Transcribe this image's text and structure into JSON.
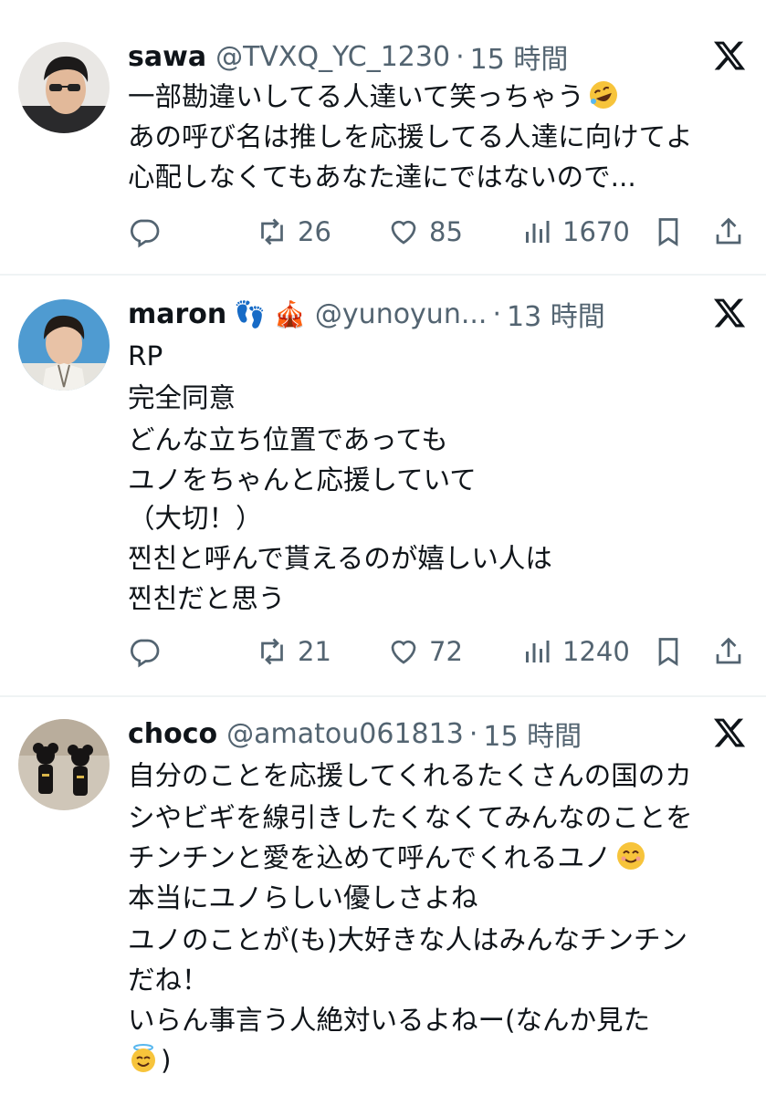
{
  "tweets": [
    {
      "name": "sawa",
      "handle": "@TVXQ_YC_1230",
      "dot": "·",
      "time": "15 時間",
      "lines": [
        "一部勘違いしてる人達いて笑っちゃう",
        "あの呼び名は推しを応援してる人達に向けてよ",
        "心配しなくてもあなた達にではないので..."
      ],
      "retweets": "26",
      "likes": "85",
      "views": "1670"
    },
    {
      "name": "maron",
      "name_emoji": "👣 🎪",
      "handle": "@yunoyun...",
      "dot": "·",
      "time": "13 時間",
      "lines": [
        "RP",
        "完全同意",
        "どんな立ち位置であっても",
        "ユノをちゃんと応援していて",
        "（大切！）",
        "찐친と呼んで貰えるのが嬉しい人は",
        "찐친だと思う"
      ],
      "retweets": "21",
      "likes": "72",
      "views": "1240"
    },
    {
      "name": "choco",
      "handle": "@amatou061813",
      "dot": "·",
      "time": "15 時間",
      "lines": [
        "自分のことを応援してくれるたくさんの国のカ",
        "シやビギを線引きしたくなくてみんなのことを",
        "チンチンと愛を込めて呼んでくれるユノ",
        "本当にユノらしい優しさよね",
        "ユノのことが(も)大好きな人はみんなチンチン",
        "だね！",
        "いらん事言う人絶対いるよねー(なんか見た",
        ")"
      ]
    }
  ],
  "icons": {
    "reply": "reply-icon",
    "retweet": "retweet-icon",
    "like": "heart-icon",
    "views": "views-icon",
    "bookmark": "bookmark-icon",
    "share": "share-icon",
    "x": "x-logo-icon"
  },
  "colors": {
    "text": "#0f1419",
    "secondary": "#536471",
    "divider": "#eff3f4"
  }
}
